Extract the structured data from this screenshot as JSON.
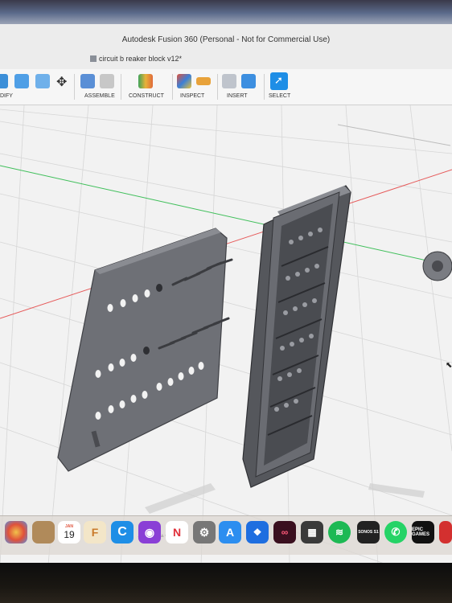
{
  "window": {
    "title": "Autodesk Fusion 360 (Personal - Not for Commercial Use)",
    "document_tab": "circuit b reaker block v12*"
  },
  "toolbar": {
    "modify_label": "DIFY",
    "assemble_label": "ASSEMBLE",
    "construct_label": "CONSTRUCT",
    "inspect_label": "INSPECT",
    "insert_label": "INSERT",
    "select_label": "SELECT"
  },
  "dock": {
    "calendar_month": "JAN",
    "calendar_day": "19",
    "sonos_label": "SONOS S1",
    "epic_label": "EPIC GAMES"
  },
  "colors": {
    "select_accent": "#1e8ee6",
    "axis_red": "#e65b5b",
    "axis_green": "#3fbf5a",
    "model_grey": "#6e7076"
  }
}
